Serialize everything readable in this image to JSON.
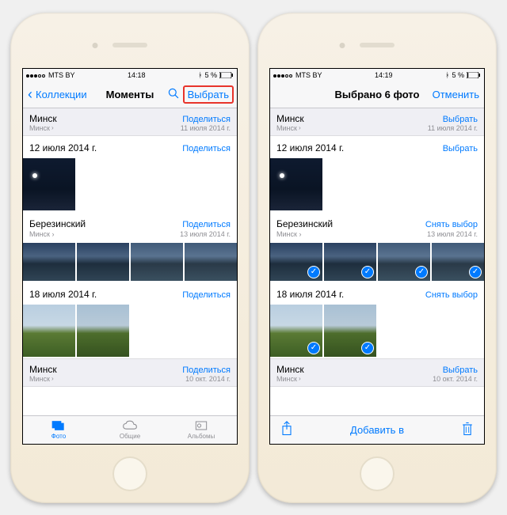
{
  "left_phone": {
    "status": {
      "carrier": "MTS BY",
      "time": "14:18",
      "battery_text": "5 %"
    },
    "nav": {
      "back": "Коллекции",
      "title": "Моменты",
      "select": "Выбрать"
    },
    "sections": [
      {
        "type": "collection",
        "title": "Минск",
        "sub": "Минск",
        "action": "Поделиться",
        "date": "11 июля 2014 г."
      },
      {
        "type": "moment",
        "title": "12 июля 2014 г.",
        "action": "Поделиться",
        "thumbs": [
          {
            "v": "dark",
            "size": "big"
          }
        ]
      },
      {
        "type": "moment",
        "title": "Березинский",
        "sub": "Минск",
        "action": "Поделиться",
        "date": "13 июля 2014 г.",
        "thumbs": [
          {
            "v": "dusk",
            "size": "small"
          },
          {
            "v": "dusk",
            "size": "small"
          },
          {
            "v": "dusk2",
            "size": "small"
          },
          {
            "v": "dusk2",
            "size": "small"
          }
        ]
      },
      {
        "type": "moment",
        "title": "18 июля 2014 г.",
        "action": "Поделиться",
        "thumbs": [
          {
            "v": "field",
            "size": "big"
          },
          {
            "v": "field2",
            "size": "big"
          }
        ]
      },
      {
        "type": "collection",
        "title": "Минск",
        "sub": "Минск",
        "action": "Поделиться",
        "date": "10 окт. 2014 г."
      }
    ],
    "tabs": {
      "photos": "Фото",
      "shared": "Общие",
      "albums": "Альбомы"
    }
  },
  "right_phone": {
    "status": {
      "carrier": "MTS BY",
      "time": "14:19",
      "battery_text": "5 %"
    },
    "nav": {
      "title": "Выбрано 6 фото",
      "cancel": "Отменить"
    },
    "sections": [
      {
        "type": "collection",
        "title": "Минск",
        "sub": "Минск",
        "action": "Выбрать",
        "date": "11 июля 2014 г."
      },
      {
        "type": "moment",
        "title": "12 июля 2014 г.",
        "action": "Выбрать",
        "thumbs": [
          {
            "v": "dark",
            "size": "big",
            "checked": false
          }
        ]
      },
      {
        "type": "moment",
        "title": "Березинский",
        "sub": "Минск",
        "action": "Снять выбор",
        "date": "13 июля 2014 г.",
        "thumbs": [
          {
            "v": "dusk",
            "size": "small",
            "checked": true
          },
          {
            "v": "dusk",
            "size": "small",
            "checked": true
          },
          {
            "v": "dusk2",
            "size": "small",
            "checked": true
          },
          {
            "v": "dusk2",
            "size": "small",
            "checked": true
          }
        ]
      },
      {
        "type": "moment",
        "title": "18 июля 2014 г.",
        "action": "Снять выбор",
        "thumbs": [
          {
            "v": "field",
            "size": "big",
            "checked": true
          },
          {
            "v": "field2",
            "size": "big",
            "checked": true
          }
        ]
      },
      {
        "type": "collection",
        "title": "Минск",
        "sub": "Минск",
        "action": "Выбрать",
        "date": "10 окт. 2014 г."
      }
    ],
    "toolbar": {
      "add_to": "Добавить в"
    }
  }
}
